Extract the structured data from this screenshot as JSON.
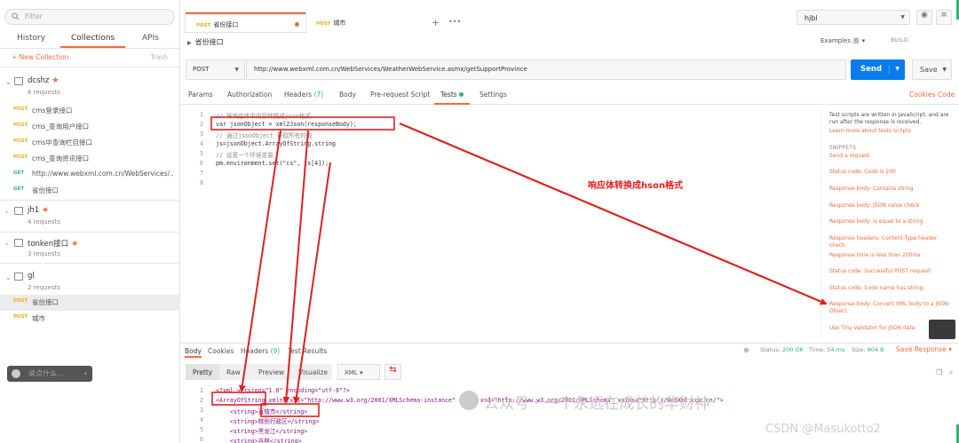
{
  "sidebar": {
    "filter_placeholder": "Filter",
    "tabs": [
      "History",
      "Collections",
      "APIs"
    ],
    "new_collection": "+ New Collection",
    "trash": "Trash",
    "collections": [
      {
        "name": "dcshz",
        "count": "6 requests",
        "starred": true
      },
      {
        "name": "jh1",
        "count": "4 requests",
        "starred": true
      },
      {
        "name": "tonken接口",
        "count": "3 requests",
        "starred": true
      },
      {
        "name": "gl",
        "count": "2 requests",
        "starred": false
      }
    ],
    "requests_dcshz": [
      {
        "method": "POST",
        "title": "cms登录接口"
      },
      {
        "method": "POST",
        "title": "cms_查询用户接口"
      },
      {
        "method": "POST",
        "title": "cms中查询栏目接口"
      },
      {
        "method": "POST",
        "title": "cms_查询资讯接口"
      },
      {
        "method": "GET",
        "title": "http://www.webxml.com.cn/WebServices/..."
      },
      {
        "method": "GET",
        "title": "省份接口"
      }
    ],
    "requests_gl": [
      {
        "method": "POST",
        "title": "省份接口"
      },
      {
        "method": "POST",
        "title": "城市"
      }
    ],
    "chat_placeholder": "说点什么..."
  },
  "tabs": [
    {
      "method": "POST",
      "label": "省份接口",
      "active": true
    },
    {
      "method": "POST",
      "label": "城市",
      "active": false
    }
  ],
  "environment": "hjbl",
  "request": {
    "name": "省份接口",
    "examples": "Examples",
    "examples_count": "0",
    "build": "BUILD",
    "method": "POST",
    "url": "http://www.webxml.com.cn/WebServices/WeatherWebService.asmx/getSupportProvince",
    "send": "Send",
    "save": "Save"
  },
  "subtabs": {
    "params": "Params",
    "authorization": "Authorization",
    "headers": "Headers",
    "headers_count": "(7)",
    "body": "Body",
    "prerequest": "Pre-request Script",
    "tests": "Tests",
    "settings": "Settings",
    "cookies": "Cookies",
    "code": "Code"
  },
  "editor": {
    "lines": [
      "// 将响应体中内容转换成json格式",
      "var jsonObject = xml2Json(responseBody);",
      "// 通过jsonObject 获取所有的值",
      "js=jsonObject.ArrayOfString.string",
      "// 设置一个环境变量",
      "pm.environment.set(\"cs\", js[4]);",
      "",
      ""
    ]
  },
  "snippets": {
    "desc": "Test scripts are written in JavaScript, and are run after the response is received.",
    "learn_more": "Learn more about tests scripts",
    "header": "SNIPPETS",
    "items": [
      "Send a request",
      "Status code: Code is 200",
      "Response body: Contains string",
      "Response body: JSON value check",
      "Response body: Is equal to a string",
      "Response headers: Content-Type header check",
      "Response time is less than 200ms",
      "Status code: Successful POST request",
      "Status code: Code name has string",
      "Response body: Convert XML body to a JSON Object",
      "Use Tiny Validator for JSON data"
    ]
  },
  "annotation": "响应体转换成hson格式",
  "response": {
    "tabs": {
      "body": "Body",
      "cookies": "Cookies",
      "headers": "Headers",
      "headers_count": "(9)",
      "test_results": "Test Results"
    },
    "status_label": "Status:",
    "status": "200 OK",
    "time_label": "Time:",
    "time": "54 ms",
    "size_label": "Size:",
    "size": "904 B",
    "save_response": "Save Response",
    "format_tabs": [
      "Pretty",
      "Raw",
      "Preview",
      "Visualize"
    ],
    "format": "XML",
    "lines": [
      "<?xml version=\"1.0\" encoding=\"utf-8\"?>",
      "<ArrayOfString xmlns:xsi=\"http://www.w3.org/2001/XMLSchema-instance\" xmlns:xsd=\"http://www.w3.org/2001/XMLSchema\" xmlns=\"http://WebXml.com.cn/\">",
      "    <string>直辖市</string>",
      "    <string>特别行政区</string>",
      "    <string>黑龙江</string>",
      "    <string>吉林</string>"
    ]
  },
  "watermark": "公众号 · 一个永远在成长的华财神",
  "csdn": "CSDN @Masukotto2",
  "colors": {
    "accent": "#f26b3a",
    "send": "#097bed",
    "green": "#2bb673",
    "annotation": "#e02020"
  }
}
